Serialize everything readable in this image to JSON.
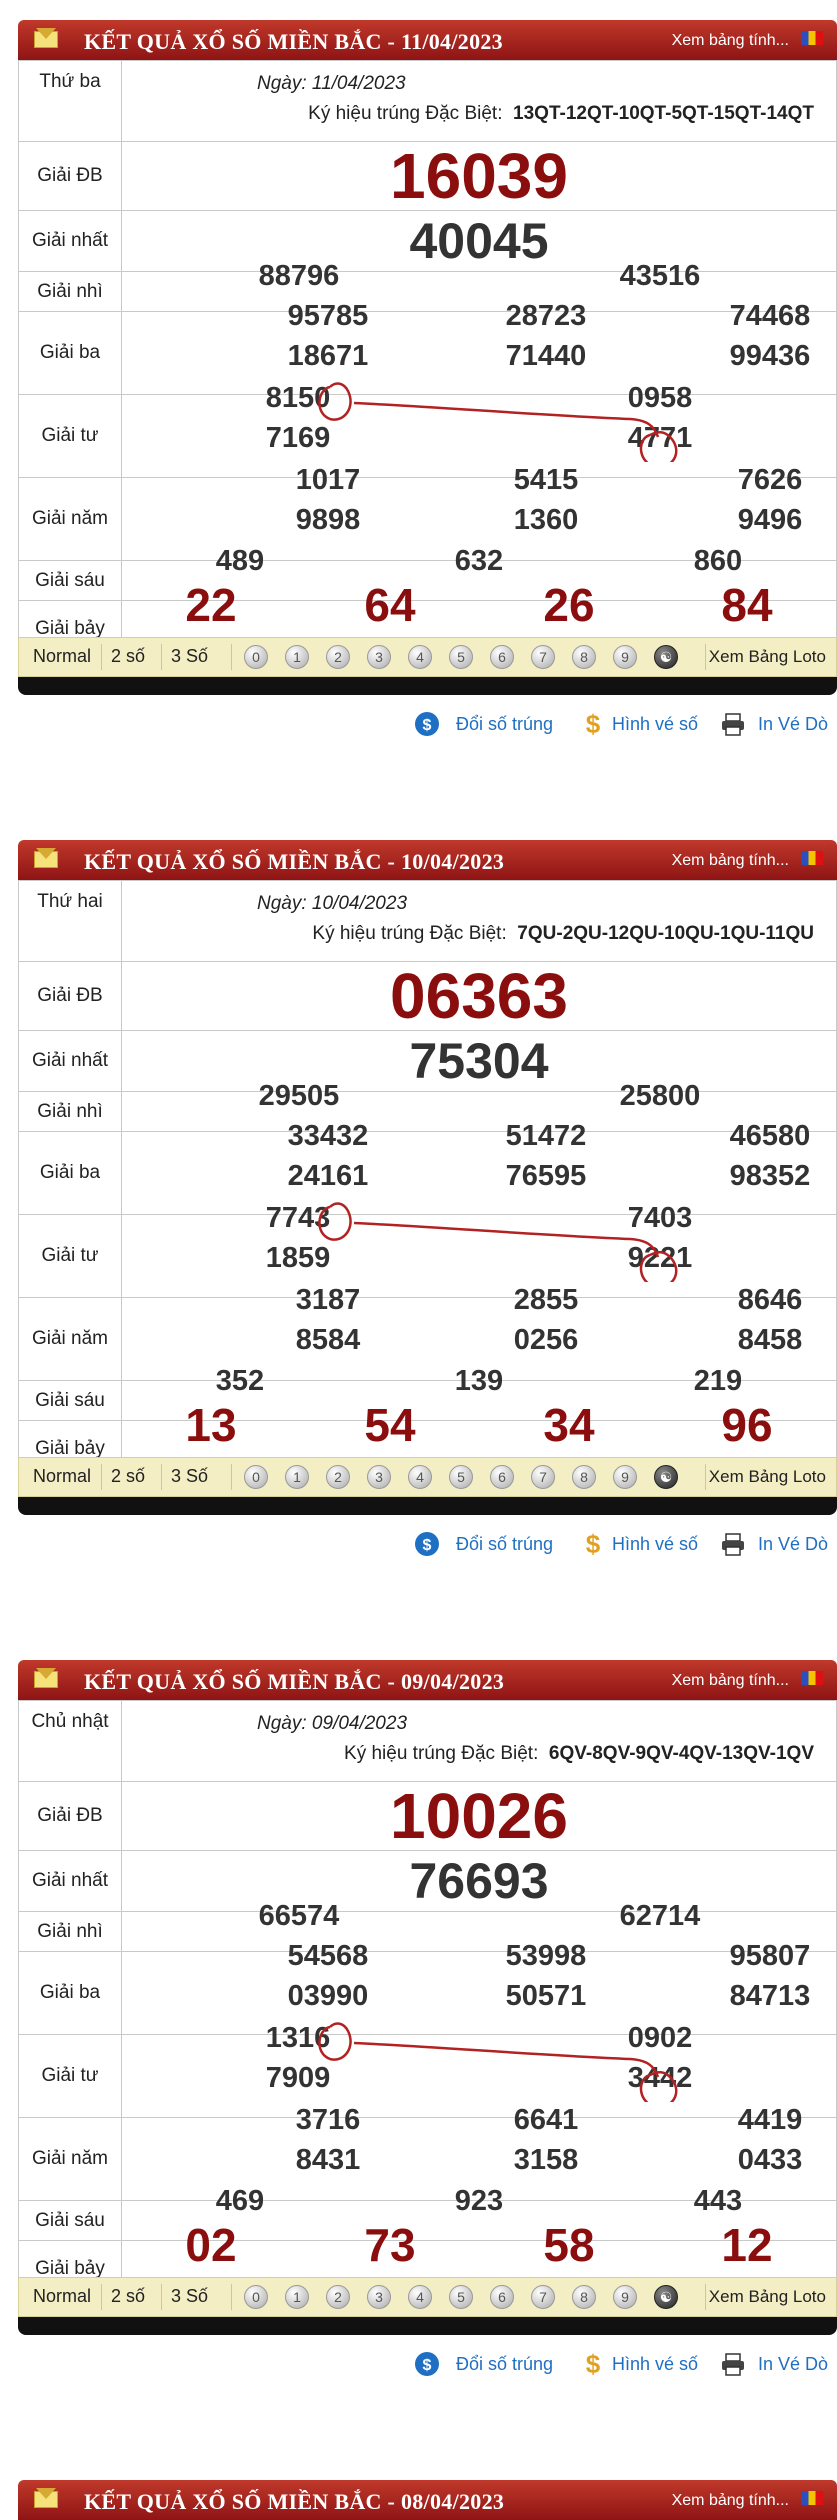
{
  "labels": {
    "g_db": "Giải ĐB",
    "g1": "Giải nhất",
    "g2": "Giải nhì",
    "g3": "Giải ba",
    "g4": "Giải tư",
    "g5": "Giải năm",
    "g6": "Giải sáu",
    "g7": "Giải bảy",
    "code_label": "Ký hiệu trúng Đặc Biệt:"
  },
  "tabs": [
    "Normal",
    "2 số",
    "3 Số"
  ],
  "balls": [
    "0",
    "1",
    "2",
    "3",
    "4",
    "5",
    "6",
    "7",
    "8",
    "9",
    "☯"
  ],
  "loto_link": "Xem Bảng Loto",
  "header_link": "Xem bảng tính...",
  "footer_links": {
    "doi": "Đổi số trúng",
    "hinh": "Hình vé số",
    "in": "In Vé Dò"
  },
  "results": [
    {
      "title": "KẾT QUẢ XỔ SỐ MIỀN BẮC - 11/04/2023",
      "weekday": "Thứ ba",
      "date": "Ngày: 11/04/2023",
      "code": "13QT-12QT-10QT-5QT-15QT-14QT",
      "db": "16039",
      "g1": "40045",
      "g2": [
        "88796",
        "43516"
      ],
      "g3": [
        "95785",
        "28723",
        "74468",
        "18671",
        "71440",
        "99436"
      ],
      "g4": [
        "8150",
        "0958",
        "7169",
        "4771"
      ],
      "g5": [
        "1017",
        "5415",
        "7626",
        "9898",
        "1360",
        "9496"
      ],
      "g6": [
        "489",
        "632",
        "860"
      ],
      "g7": [
        "22",
        "64",
        "26",
        "84"
      ]
    },
    {
      "title": "KẾT QUẢ XỔ SỐ MIỀN BẮC - 10/04/2023",
      "weekday": "Thứ hai",
      "date": "Ngày: 10/04/2023",
      "code": "7QU-2QU-12QU-10QU-1QU-11QU",
      "db": "06363",
      "g1": "75304",
      "g2": [
        "29505",
        "25800"
      ],
      "g3": [
        "33432",
        "51472",
        "46580",
        "24161",
        "76595",
        "98352"
      ],
      "g4": [
        "7743",
        "7403",
        "1859",
        "9221"
      ],
      "g5": [
        "3187",
        "2855",
        "8646",
        "8584",
        "0256",
        "8458"
      ],
      "g6": [
        "352",
        "139",
        "219"
      ],
      "g7": [
        "13",
        "54",
        "34",
        "96"
      ]
    },
    {
      "title": "KẾT QUẢ XỔ SỐ MIỀN BẮC - 09/04/2023",
      "weekday": "Chủ nhật",
      "date": "Ngày: 09/04/2023",
      "code": "6QV-8QV-9QV-4QV-13QV-1QV",
      "db": "10026",
      "g1": "76693",
      "g2": [
        "66574",
        "62714"
      ],
      "g3": [
        "54568",
        "53998",
        "95807",
        "03990",
        "50571",
        "84713"
      ],
      "g4": [
        "1316",
        "0902",
        "7909",
        "3442"
      ],
      "g5": [
        "3716",
        "6641",
        "4419",
        "8431",
        "3158",
        "0433"
      ],
      "g6": [
        "469",
        "923",
        "443"
      ],
      "g7": [
        "02",
        "73",
        "58",
        "12"
      ]
    },
    {
      "title": "KẾT QUẢ XỔ SỐ MIỀN BẮC - 08/04/2023"
    }
  ],
  "colors": {
    "header_red": "#a52020",
    "number_red": "#8b0e0e",
    "bar_cream": "#f4eec5",
    "link_blue": "#1f6fc2",
    "annotation_red": "#b22222"
  }
}
